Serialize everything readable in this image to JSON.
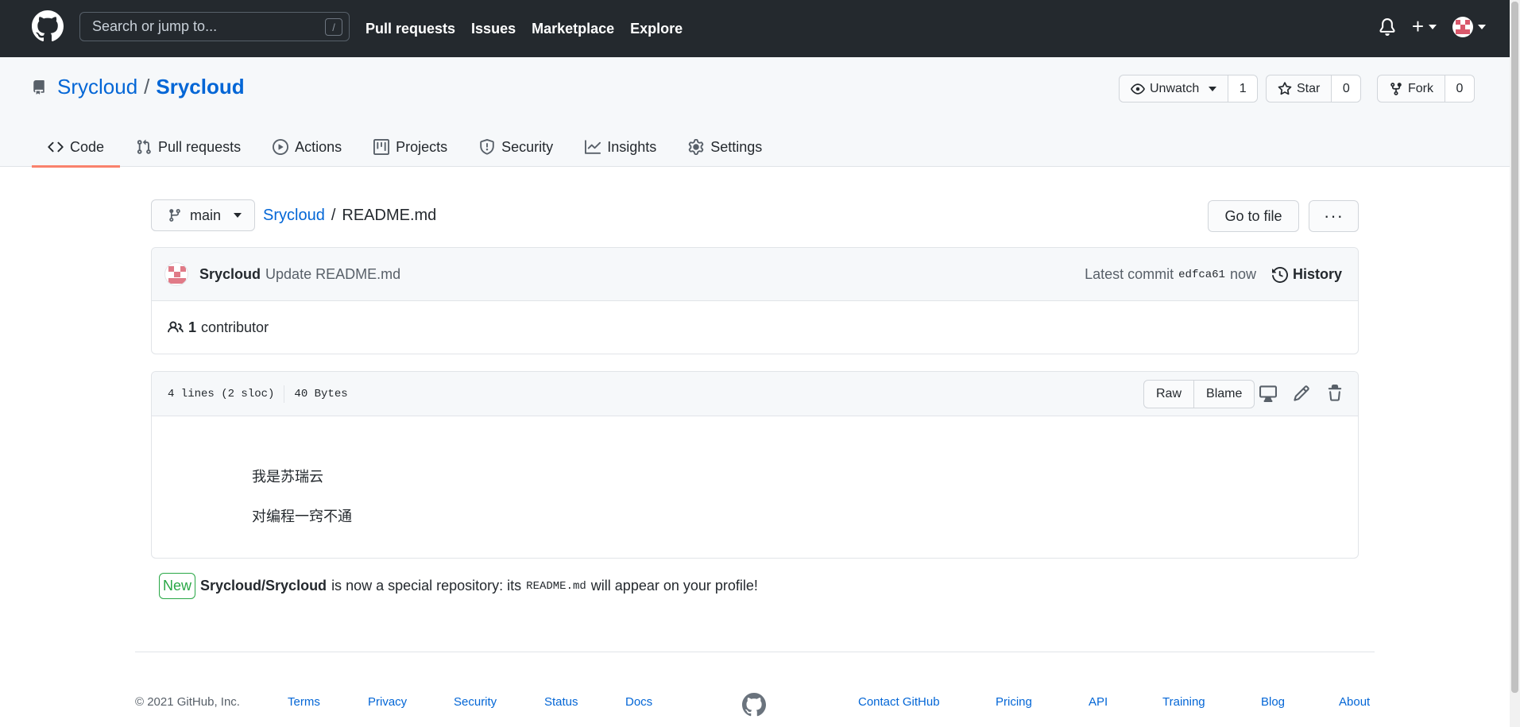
{
  "header": {
    "search_placeholder": "Search or jump to...",
    "search_shortcut": "/",
    "nav": [
      "Pull requests",
      "Issues",
      "Marketplace",
      "Explore"
    ],
    "plus": "+"
  },
  "repo": {
    "owner": "Srycloud",
    "separator": "/",
    "name": "Srycloud",
    "watch_label": "Unwatch",
    "watch_count": "1",
    "star_label": "Star",
    "star_count": "0",
    "fork_label": "Fork",
    "fork_count": "0",
    "tabs": [
      "Code",
      "Pull requests",
      "Actions",
      "Projects",
      "Security",
      "Insights",
      "Settings"
    ]
  },
  "file_nav": {
    "branch": "main",
    "crumb_repo": "Srycloud",
    "crumb_sep": "/",
    "crumb_file": "README.md",
    "goto_label": "Go to file",
    "more_label": "···"
  },
  "commit": {
    "author": "Srycloud",
    "message": "Update README.md",
    "latest_label": "Latest commit",
    "sha": "edfca61",
    "time": "now",
    "history_label": "History",
    "contrib_count": "1",
    "contrib_label": "contributor"
  },
  "file": {
    "lines": "4 lines (2 sloc)",
    "size": "40 Bytes",
    "raw_label": "Raw",
    "blame_label": "Blame",
    "content": [
      "我是苏瑞云",
      "对编程一窍不通"
    ]
  },
  "notice": {
    "badge": "New",
    "repo": "Srycloud/Srycloud",
    "text1": "is now a special repository: its",
    "code": "README.md",
    "text2": "will appear on your profile!"
  },
  "footer": {
    "copyright": "© 2021 GitHub, Inc.",
    "left_links": [
      "Terms",
      "Privacy",
      "Security",
      "Status",
      "Docs"
    ],
    "right_links": [
      "Contact GitHub",
      "Pricing",
      "API",
      "Training",
      "Blog",
      "About"
    ]
  },
  "colors": {
    "header_bg": "#24292e",
    "link": "#0366d6",
    "active_tab": "#f9826c",
    "new_badge": "#28a745"
  }
}
